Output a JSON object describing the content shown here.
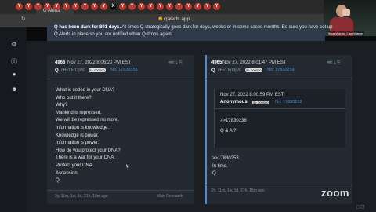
{
  "browser": {
    "url": "qalerts.app",
    "active_tab_label": "Q Alerts",
    "tab_icon_letters": [
      "Y",
      "Y",
      "Y",
      "Y",
      "Y",
      "Y",
      "Y",
      "Y",
      "Y",
      "Y",
      "X",
      "Y",
      "Y",
      "Y",
      "Y",
      "Y",
      "Y",
      "Y",
      "Y",
      "Y",
      "Y",
      "Y"
    ]
  },
  "webcam": {
    "label": "TexasWarrior LiamWarner"
  },
  "banner": {
    "lead": "Q has been dark for 891 days.",
    "rest": "At times Q strategically goes dark for days, weeks or in some cases months. Be sure you have set up",
    "line2": "Q Alerts in place so you are notified when Q drops again."
  },
  "posts": [
    {
      "number": "4966",
      "date": "Nov 27, 2022 8:06:20 PM EST",
      "author": "Q",
      "tripcode": "!!Hs1Jq13jV6",
      "id_badge": "ID: 000000",
      "post_link": "No. 17830355",
      "body": [
        "What is coded in your DNA?",
        "Who put it there?",
        "Why?",
        "Mankind is repressed.",
        "We will be repressed no more.",
        "Information is knowledge.",
        "Knowledge is power.",
        "Information is power.",
        "How do you protect your DNA?",
        "There is a war for your DNA.",
        "Protect your DNA.",
        "Ascension.",
        "Q"
      ],
      "footer_left": "2y, 11m, 1w, 1d, 21h, 16m ago",
      "footer_right": "Main Research"
    },
    {
      "number": "4965",
      "date": "Nov 27, 2022 8:01:47 PM EST",
      "author": "Q",
      "tripcode": "!!Hs1Jq13jV6",
      "id_badge": "ID: 000000",
      "post_link": "No. 17830259",
      "quote": {
        "date": "Nov 27, 2022 8:00:59 PM EST",
        "name": "Anonymous",
        "id_badge": "ID: 000000",
        "link": "No. 17830253",
        "body": [
          ">>17830238",
          "Q & A ?"
        ]
      },
      "body": [
        ">>17830253",
        "In time.",
        "Q"
      ],
      "footer_left": "2y, 11m, 1w, 1d, 21h, 16m ago"
    }
  ],
  "zoom_watermark": "zoom",
  "colors": {
    "accent": "#4c8ed6",
    "banner": "#2f3b4a",
    "card": "#242a31",
    "page": "#1b1f24"
  }
}
